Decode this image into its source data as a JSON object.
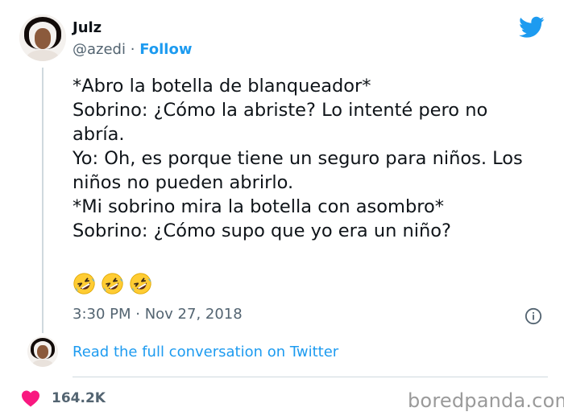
{
  "author": {
    "name": "Julz",
    "handle": "@azedi",
    "separator": "·",
    "follow_label": "Follow"
  },
  "tweet": {
    "lines": [
      "*Abro la botella de blanqueador*",
      "Sobrino: ¿Cómo la abriste? Lo intenté pero no",
      "abría.",
      "Yo: Oh, es porque tiene un seguro para niños. Los",
      "niños no pueden abrirlo.",
      "*Mi sobrino mira la botella con asombro*",
      "Sobrino: ¿Cómo supo que yo era un niño?"
    ],
    "emojis": [
      "rolling-on-floor-laughing",
      "rolling-on-floor-laughing",
      "rolling-on-floor-laughing"
    ],
    "timestamp": "3:30 PM · Nov 27, 2018"
  },
  "conversation_link": "Read the full conversation on Twitter",
  "likes": "164.2K",
  "watermark": "boredpanda.com",
  "colors": {
    "twitter_blue": "#1d9bf0",
    "heart": "#f91880",
    "muted_text": "#536471",
    "divider": "#cfd9de"
  },
  "icons": {
    "brand": "twitter-bird-icon",
    "info": "info-icon",
    "like": "heart-icon"
  }
}
